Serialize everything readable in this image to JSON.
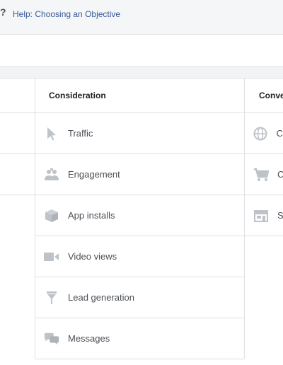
{
  "top": {
    "question_mark": "?",
    "help_link": "Help: Choosing an Objective"
  },
  "columns": {
    "consideration": {
      "header": "Consideration",
      "items": [
        {
          "label": "Traffic",
          "icon": "cursor-icon"
        },
        {
          "label": "Engagement",
          "icon": "people-icon"
        },
        {
          "label": "App installs",
          "icon": "box-icon"
        },
        {
          "label": "Video views",
          "icon": "video-camera-icon"
        },
        {
          "label": "Lead generation",
          "icon": "funnel-icon"
        },
        {
          "label": "Messages",
          "icon": "chat-bubbles-icon"
        }
      ]
    },
    "conversion": {
      "header": "Conve",
      "items": [
        {
          "label": "C",
          "icon": "globe-icon"
        },
        {
          "label": "C",
          "icon": "cart-icon"
        },
        {
          "label": "S",
          "icon": "store-icon"
        }
      ]
    }
  },
  "colors": {
    "icon": "#bec3c9",
    "border": "#dddfe2",
    "link": "#365899"
  }
}
